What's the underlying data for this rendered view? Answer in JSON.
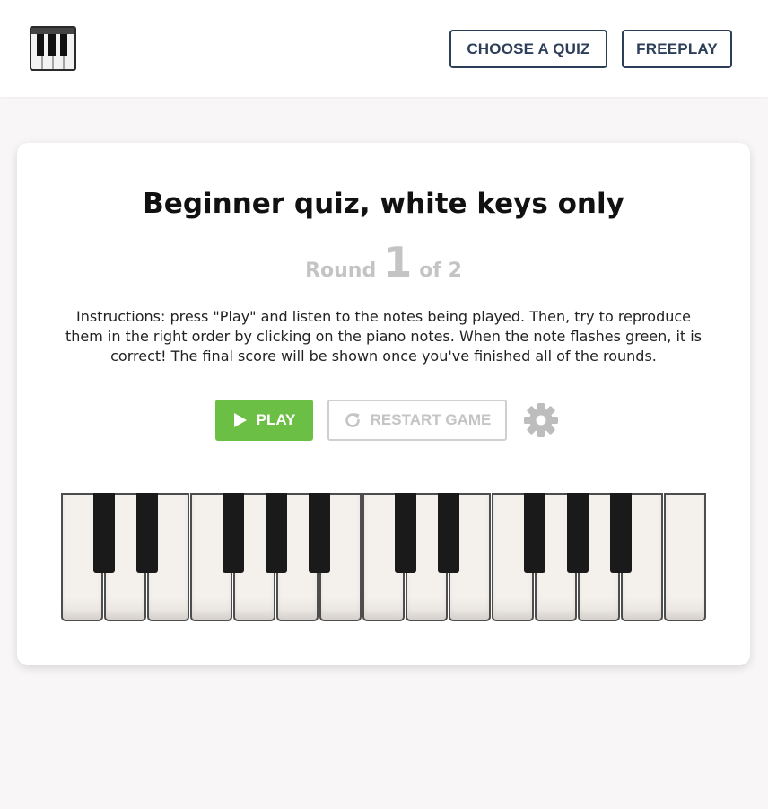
{
  "header": {
    "logo_icon": "piano-keys-icon",
    "nav": {
      "choose_quiz_label": "CHOOSE A QUIZ",
      "freeplay_label": "FREEPLAY"
    }
  },
  "quiz": {
    "title": "Beginner quiz, white keys only",
    "round_prefix": "Round",
    "round_current": "1",
    "round_suffix": "of 2",
    "instructions": "Instructions: press \"Play\" and listen to the notes being played. Then, try to reproduce them in the right order by clicking on the piano notes. When the note flashes green, it is correct! The final score will be shown once you've finished all of the rounds."
  },
  "controls": {
    "play_label": "PLAY",
    "play_icon": "play-triangle-icon",
    "restart_label": "RESTART GAME",
    "restart_icon": "restart-arrow-icon",
    "settings_icon": "gear-icon"
  },
  "colors": {
    "accent_green": "#6cbf45",
    "nav_dark": "#2c3e58",
    "disabled_gray": "#c4c4c4"
  },
  "piano": {
    "white_keys": 15,
    "black_keys": 10
  }
}
